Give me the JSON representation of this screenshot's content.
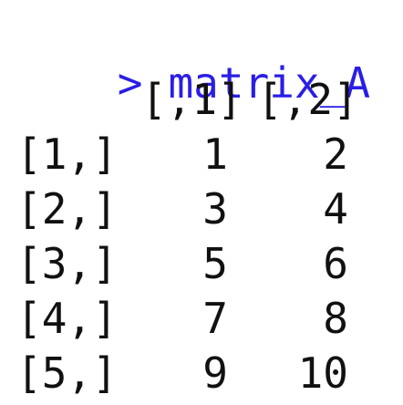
{
  "console": {
    "prompt_symbol": ">",
    "command": "matrix_A",
    "colors": {
      "prompt": "#2a1ee6",
      "output": "#111111",
      "background": "#ffffff"
    }
  },
  "matrix": {
    "column_headers": [
      "[,1]",
      "[,2]"
    ],
    "rows": [
      {
        "label": "[1,]",
        "values": [
          "1",
          "2"
        ]
      },
      {
        "label": "[2,]",
        "values": [
          "3",
          "4"
        ]
      },
      {
        "label": "[3,]",
        "values": [
          "5",
          "6"
        ]
      },
      {
        "label": "[4,]",
        "values": [
          "7",
          "8"
        ]
      },
      {
        "label": "[5,]",
        "values": [
          "9",
          "10"
        ]
      }
    ]
  }
}
